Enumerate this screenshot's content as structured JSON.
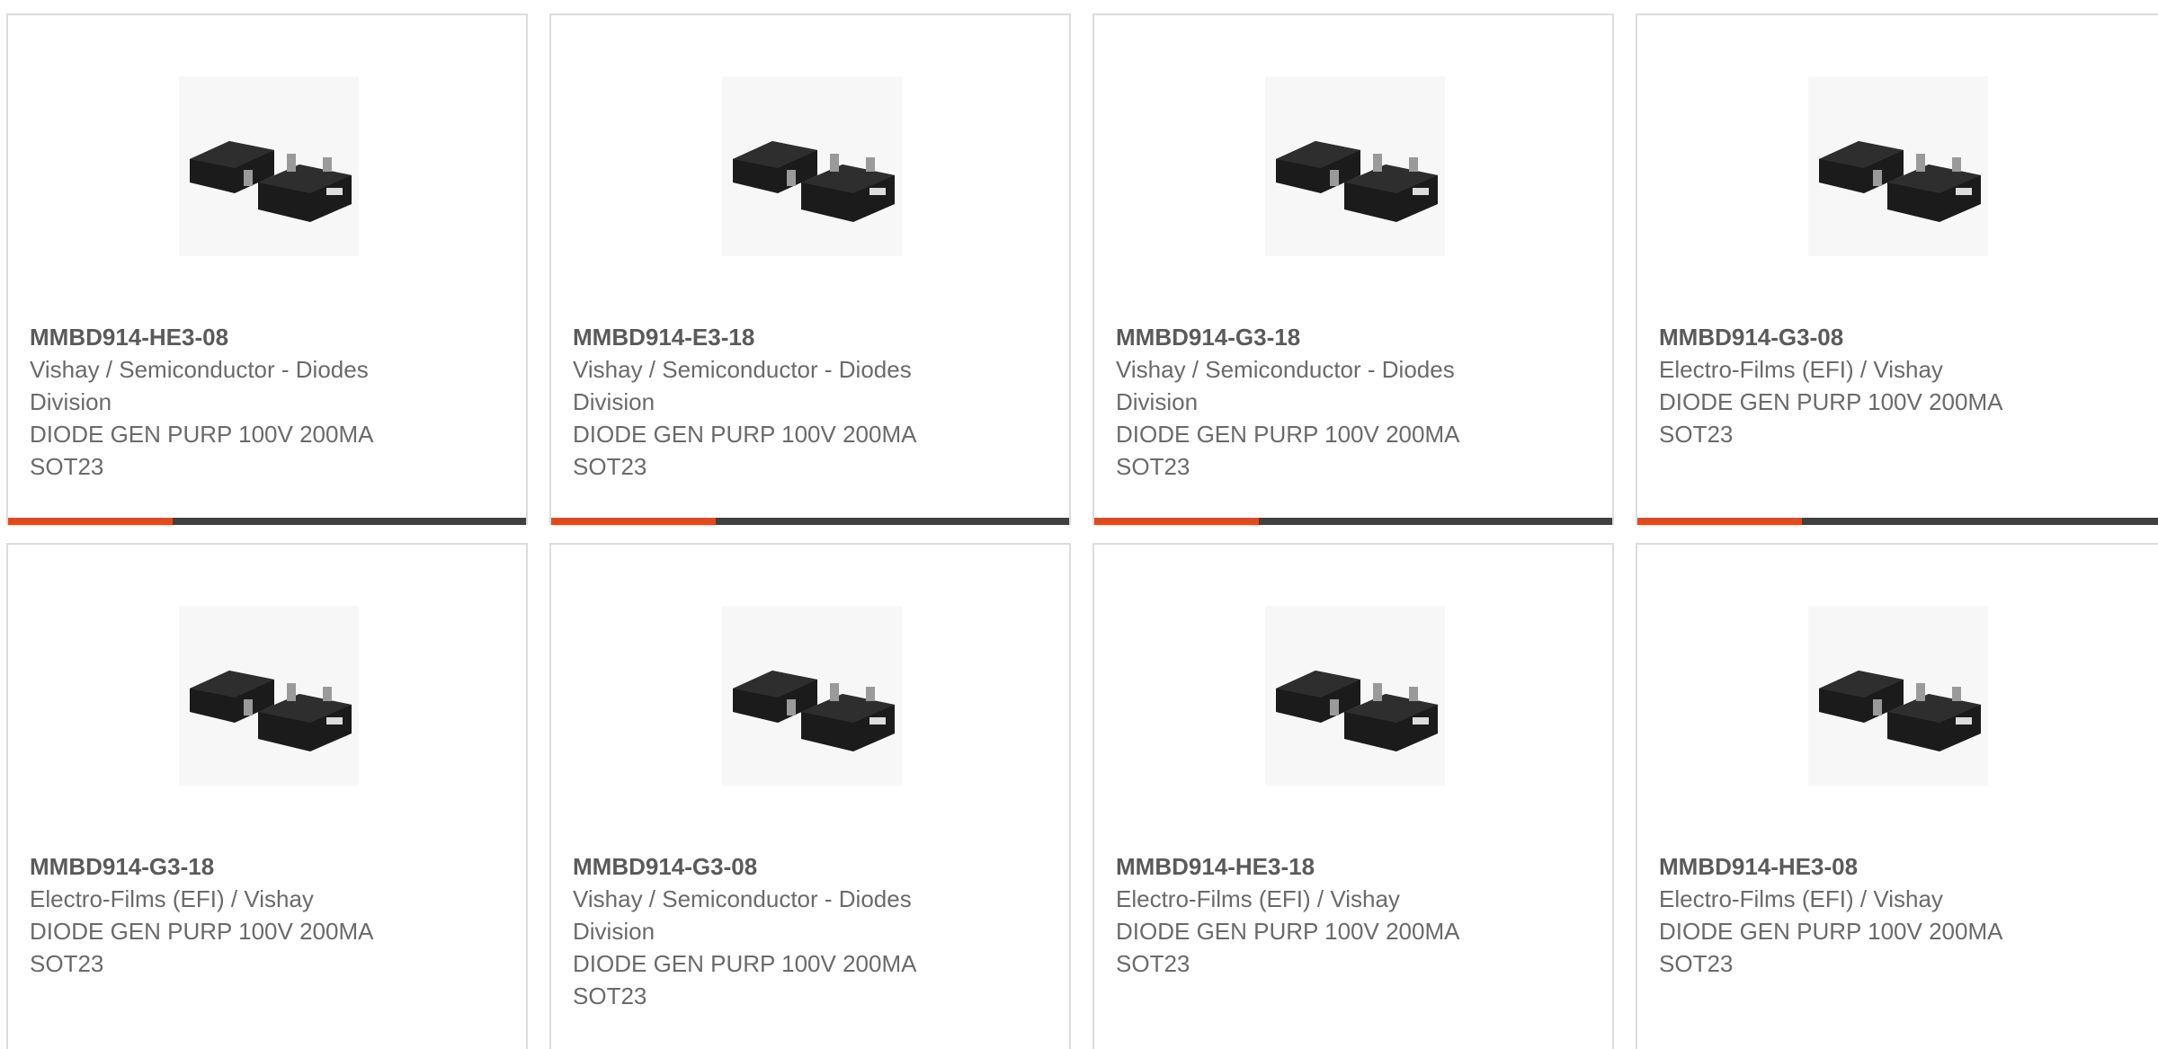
{
  "colors": {
    "accent": "#e04a1f",
    "bar": "#404040",
    "border": "#dcdcdc",
    "text": "#6a6a6a",
    "title": "#5a5a5a"
  },
  "product_image_icon": "sot23-package-icon",
  "cards": [
    {
      "part": "MMBD914-HE3-08",
      "manufacturer": "Vishay / Semiconductor - Diodes Division",
      "description": "DIODE GEN PURP 100V 200MA SOT23"
    },
    {
      "part": "MMBD914-E3-18",
      "manufacturer": "Vishay / Semiconductor - Diodes Division",
      "description": "DIODE GEN PURP 100V 200MA SOT23"
    },
    {
      "part": "MMBD914-G3-18",
      "manufacturer": "Vishay / Semiconductor - Diodes Division",
      "description": "DIODE GEN PURP 100V 200MA SOT23"
    },
    {
      "part": "MMBD914-G3-08",
      "manufacturer": "Electro-Films (EFI) / Vishay",
      "description": "DIODE GEN PURP 100V 200MA SOT23"
    },
    {
      "part": "MMBD914-G3-18",
      "manufacturer": "Electro-Films (EFI) / Vishay",
      "description": "DIODE GEN PURP 100V 200MA SOT23"
    },
    {
      "part": "MMBD914-G3-08",
      "manufacturer": "Vishay / Semiconductor - Diodes Division",
      "description": "DIODE GEN PURP 100V 200MA SOT23"
    },
    {
      "part": "MMBD914-HE3-18",
      "manufacturer": "Electro-Films (EFI) / Vishay",
      "description": "DIODE GEN PURP 100V 200MA SOT23"
    },
    {
      "part": "MMBD914-HE3-08",
      "manufacturer": "Electro-Films (EFI) / Vishay",
      "description": "DIODE GEN PURP 100V 200MA SOT23"
    }
  ]
}
